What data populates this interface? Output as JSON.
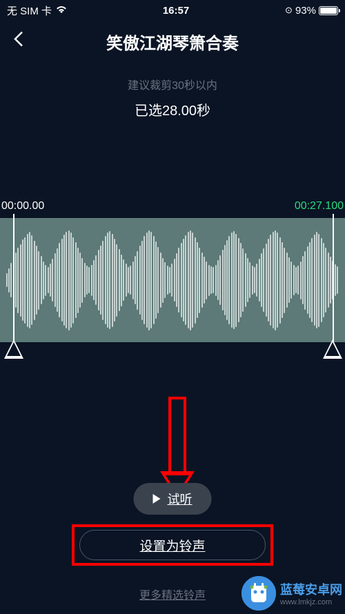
{
  "status": {
    "carrier": "无 SIM 卡",
    "time": "16:57",
    "battery_percent": "93%"
  },
  "header": {
    "title": "笑傲江湖琴箫合奏"
  },
  "hint": {
    "text": "建议裁剪30秒以内",
    "selected": "已选28.00秒"
  },
  "timeline": {
    "start": "00:00.00",
    "end": "00:27.100"
  },
  "buttons": {
    "preview": "试听",
    "set_ringtone": "设置为铃声",
    "more": "更多精选铃声"
  },
  "watermark": {
    "name": "蓝莓安卓网",
    "url": "www.lmkjz.com"
  }
}
